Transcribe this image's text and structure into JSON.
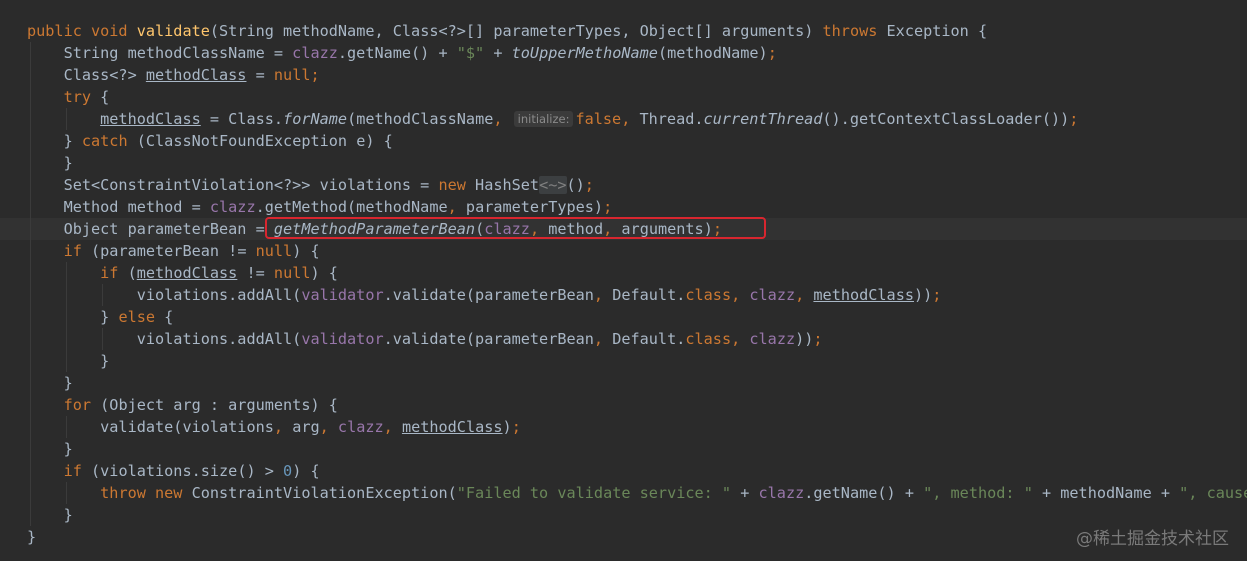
{
  "editor": {
    "lines": [
      [
        {
          "t": "public void ",
          "c": "kw"
        },
        {
          "t": "validate",
          "c": "mc"
        },
        {
          "t": "(String methodName, Class<?>[] parameterTypes, Object[] arguments) "
        },
        {
          "t": "throws ",
          "c": "kw"
        },
        {
          "t": "Exception {"
        }
      ],
      [
        {
          "t": "    String methodClassName = "
        },
        {
          "t": "clazz",
          "c": "fld"
        },
        {
          "t": ".getName() + "
        },
        {
          "t": "\"$\"",
          "c": "str"
        },
        {
          "t": " + "
        },
        {
          "t": "toUpperMethoName",
          "c": "st"
        },
        {
          "t": "(methodName)"
        },
        {
          "t": ";",
          "c": "kw"
        }
      ],
      [
        {
          "t": "    Class<?> "
        },
        {
          "t": "methodClass",
          "c": "ul"
        },
        {
          "t": " = "
        },
        {
          "t": "null",
          "c": "kw"
        },
        {
          "t": ";",
          "c": "kw"
        }
      ],
      [
        {
          "t": "    "
        },
        {
          "t": "try ",
          "c": "kw"
        },
        {
          "t": "{"
        }
      ],
      [
        {
          "t": "        "
        },
        {
          "t": "methodClass",
          "c": "ul"
        },
        {
          "t": " = Class."
        },
        {
          "t": "forName",
          "c": "st"
        },
        {
          "t": "(methodClassName"
        },
        {
          "t": ", ",
          "c": "kw"
        },
        {
          "t": "initialize:",
          "c": "hint"
        },
        {
          "t": "false",
          "c": "kw"
        },
        {
          "t": ", ",
          "c": "kw"
        },
        {
          "t": "Thread."
        },
        {
          "t": "currentThread",
          "c": "st"
        },
        {
          "t": "().getContextClassLoader())"
        },
        {
          "t": ";",
          "c": "kw"
        }
      ],
      [
        {
          "t": "    } "
        },
        {
          "t": "catch ",
          "c": "kw"
        },
        {
          "t": "(ClassNotFoundException e) {"
        }
      ],
      [
        {
          "t": "    }"
        }
      ],
      [
        {
          "t": "    Set<ConstraintViolation<?>> violations = "
        },
        {
          "t": "new ",
          "c": "kw"
        },
        {
          "t": "HashSet"
        },
        {
          "t": "<~>",
          "c": "fold"
        },
        {
          "t": "()"
        },
        {
          "t": ";",
          "c": "kw"
        }
      ],
      [
        {
          "t": "    Method method = "
        },
        {
          "t": "clazz",
          "c": "fld"
        },
        {
          "t": ".getMethod(methodName"
        },
        {
          "t": ", ",
          "c": "kw"
        },
        {
          "t": "parameterTypes)"
        },
        {
          "t": ";",
          "c": "kw"
        }
      ],
      [
        {
          "t": "    Object parameterBean = "
        },
        {
          "t": "getMethodParameterBean",
          "c": "st"
        },
        {
          "t": "("
        },
        {
          "t": "clazz",
          "c": "fld"
        },
        {
          "t": ", ",
          "c": "kw"
        },
        {
          "t": "method"
        },
        {
          "t": ", ",
          "c": "kw"
        },
        {
          "t": "arguments)"
        },
        {
          "t": ";",
          "c": "kw"
        }
      ],
      [
        {
          "t": "    "
        },
        {
          "t": "if ",
          "c": "kw"
        },
        {
          "t": "(parameterBean != "
        },
        {
          "t": "null",
          "c": "kw"
        },
        {
          "t": ") {"
        }
      ],
      [
        {
          "t": "        "
        },
        {
          "t": "if ",
          "c": "kw"
        },
        {
          "t": "("
        },
        {
          "t": "methodClass",
          "c": "ul"
        },
        {
          "t": " != "
        },
        {
          "t": "null",
          "c": "kw"
        },
        {
          "t": ") {"
        }
      ],
      [
        {
          "t": "            violations.addAll("
        },
        {
          "t": "validator",
          "c": "fld"
        },
        {
          "t": ".validate(parameterBean"
        },
        {
          "t": ", ",
          "c": "kw"
        },
        {
          "t": "Default."
        },
        {
          "t": "class",
          "c": "kw"
        },
        {
          "t": ", ",
          "c": "kw"
        },
        {
          "t": "clazz",
          "c": "fld"
        },
        {
          "t": ", ",
          "c": "kw"
        },
        {
          "t": "methodClass",
          "c": "ul"
        },
        {
          "t": "))"
        },
        {
          "t": ";",
          "c": "kw"
        }
      ],
      [
        {
          "t": "        } "
        },
        {
          "t": "else ",
          "c": "kw"
        },
        {
          "t": "{"
        }
      ],
      [
        {
          "t": "            violations.addAll("
        },
        {
          "t": "validator",
          "c": "fld"
        },
        {
          "t": ".validate(parameterBean"
        },
        {
          "t": ", ",
          "c": "kw"
        },
        {
          "t": "Default."
        },
        {
          "t": "class",
          "c": "kw"
        },
        {
          "t": ", ",
          "c": "kw"
        },
        {
          "t": "clazz",
          "c": "fld"
        },
        {
          "t": "))"
        },
        {
          "t": ";",
          "c": "kw"
        }
      ],
      [
        {
          "t": "        }"
        }
      ],
      [
        {
          "t": "    }"
        }
      ],
      [
        {
          "t": "    "
        },
        {
          "t": "for ",
          "c": "kw"
        },
        {
          "t": "(Object arg : arguments) {"
        }
      ],
      [
        {
          "t": "        validate(violations"
        },
        {
          "t": ", ",
          "c": "kw"
        },
        {
          "t": "arg"
        },
        {
          "t": ", ",
          "c": "kw"
        },
        {
          "t": "clazz",
          "c": "fld"
        },
        {
          "t": ", ",
          "c": "kw"
        },
        {
          "t": "methodClass",
          "c": "ul"
        },
        {
          "t": ")"
        },
        {
          "t": ";",
          "c": "kw"
        }
      ],
      [
        {
          "t": "    }"
        }
      ],
      [
        {
          "t": "    "
        },
        {
          "t": "if ",
          "c": "kw"
        },
        {
          "t": "(violations.size() > "
        },
        {
          "t": "0",
          "c": "num"
        },
        {
          "t": ") {"
        }
      ],
      [
        {
          "t": "        "
        },
        {
          "t": "throw new ",
          "c": "kw"
        },
        {
          "t": "ConstraintViolationException("
        },
        {
          "t": "\"Failed to validate service: \"",
          "c": "str"
        },
        {
          "t": " + "
        },
        {
          "t": "clazz",
          "c": "fld"
        },
        {
          "t": ".getName() + "
        },
        {
          "t": "\", method: \"",
          "c": "str"
        },
        {
          "t": " + methodName + "
        },
        {
          "t": "\", cause: ",
          "c": "str"
        }
      ],
      [
        {
          "t": "    }"
        }
      ],
      [
        {
          "t": "}"
        }
      ]
    ],
    "current_line": 9
  },
  "watermark": "@稀土掘金技术社区"
}
